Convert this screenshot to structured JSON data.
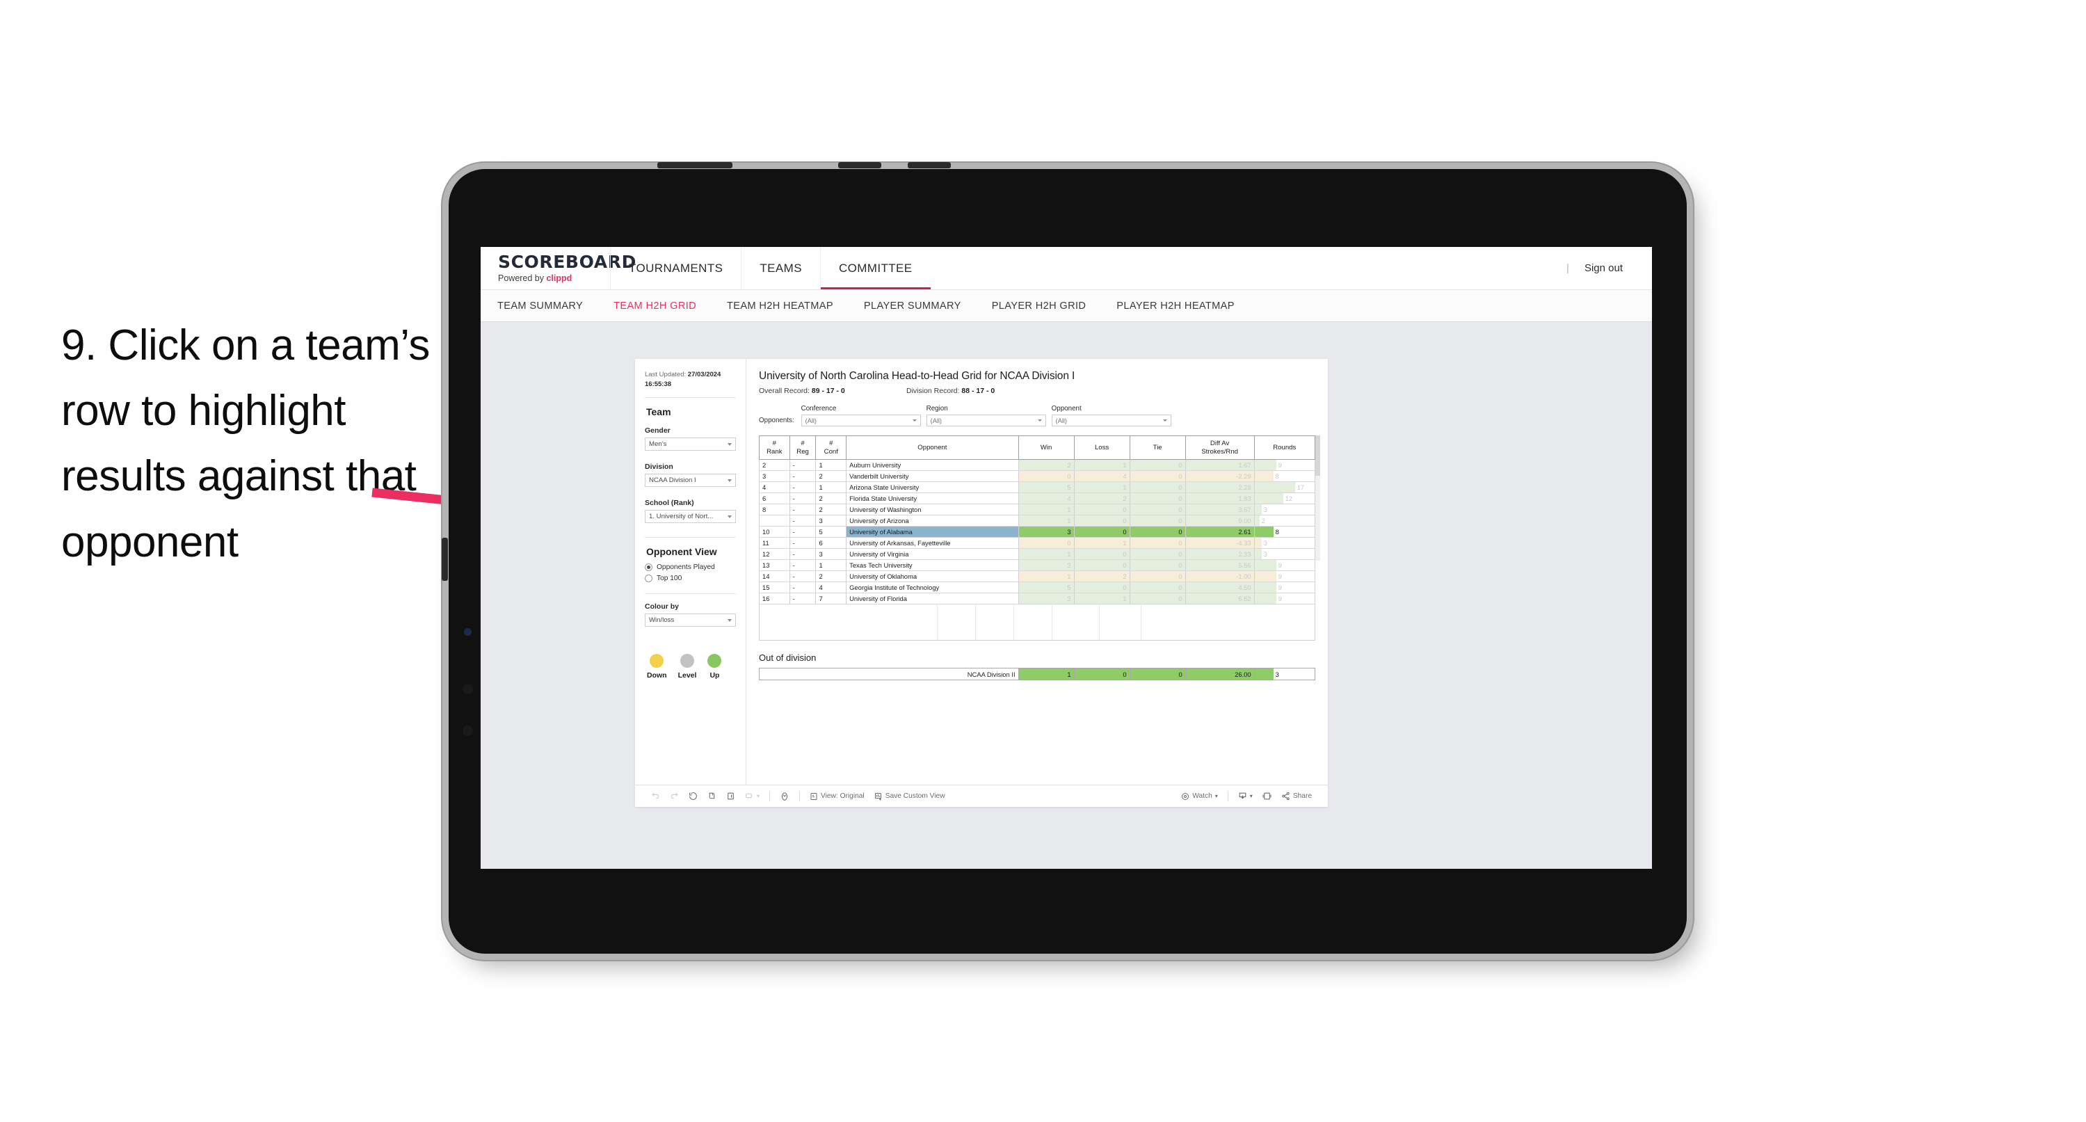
{
  "annotation": {
    "text": "9. Click on a team’s row to highlight results against that opponent",
    "arrow_color": "#ec2d62"
  },
  "app": {
    "brand_name": "SCOREBOARD",
    "brand_powered_prefix": "Powered by ",
    "brand_powered_name": "clippd",
    "top_nav": [
      {
        "label": "TOURNAMENTS",
        "active": false
      },
      {
        "label": "TEAMS",
        "active": false
      },
      {
        "label": "COMMITTEE",
        "active": true
      }
    ],
    "sign_out": "Sign out",
    "sub_nav": [
      {
        "label": "TEAM SUMMARY",
        "active": false
      },
      {
        "label": "TEAM H2H GRID",
        "active": true
      },
      {
        "label": "TEAM H2H HEATMAP",
        "active": false
      },
      {
        "label": "PLAYER SUMMARY",
        "active": false
      },
      {
        "label": "PLAYER H2H GRID",
        "active": false
      },
      {
        "label": "PLAYER H2H HEATMAP",
        "active": false
      }
    ],
    "accent_color": "#e8315f"
  },
  "sidebar": {
    "last_updated_label": "Last Updated: ",
    "last_updated_value": "27/03/2024 16:55:38",
    "team_heading": "Team",
    "gender_label": "Gender",
    "gender_value": "Men’s",
    "division_label": "Division",
    "division_value": "NCAA Division I",
    "school_label": "School (Rank)",
    "school_value": "1. University of Nort...",
    "opponent_view_heading": "Opponent View",
    "opponent_view_options": [
      {
        "label": "Opponents Played",
        "selected": true
      },
      {
        "label": "Top 100",
        "selected": false
      }
    ],
    "colour_by_label": "Colour by",
    "colour_by_value": "Win/loss",
    "legend": [
      {
        "label": "Down",
        "color": "#f2d24b"
      },
      {
        "label": "Level",
        "color": "#c2c2c2"
      },
      {
        "label": "Up",
        "color": "#86c75f"
      }
    ]
  },
  "viz": {
    "title": "University of North Carolina Head-to-Head Grid for NCAA Division I",
    "overall_record_label": "Overall Record: ",
    "overall_record_value": "89 - 17 - 0",
    "division_record_label": "Division Record: ",
    "division_record_value": "88 - 17 - 0",
    "opponents_label": "Opponents:",
    "filters": [
      {
        "label": "Conference",
        "value": "(All)"
      },
      {
        "label": "Region",
        "value": "(All)"
      },
      {
        "label": "Opponent",
        "value": "(All)"
      }
    ],
    "columns": [
      {
        "line1": "#",
        "line2": "Rank"
      },
      {
        "line1": "#",
        "line2": "Reg"
      },
      {
        "line1": "#",
        "line2": "Conf"
      },
      {
        "line1": "Opponent",
        "line2": ""
      },
      {
        "line1": "Win",
        "line2": ""
      },
      {
        "line1": "Loss",
        "line2": ""
      },
      {
        "line1": "Tie",
        "line2": ""
      },
      {
        "line1": "Diff Av",
        "line2": "Strokes/Rnd"
      },
      {
        "line1": "Rounds",
        "line2": ""
      }
    ],
    "rows": [
      {
        "rank": "2",
        "reg": "-",
        "conf": "1",
        "opponent": "Auburn University",
        "win": "2",
        "loss": "1",
        "tie": "0",
        "diff": "1.67",
        "rounds": "9",
        "tone": "up",
        "selected": false
      },
      {
        "rank": "3",
        "reg": "-",
        "conf": "2",
        "opponent": "Vanderbilt University",
        "win": "0",
        "loss": "4",
        "tie": "0",
        "diff": "-2.29",
        "rounds": "8",
        "tone": "down",
        "selected": false
      },
      {
        "rank": "4",
        "reg": "-",
        "conf": "1",
        "opponent": "Arizona State University",
        "win": "5",
        "loss": "1",
        "tie": "0",
        "diff": "2.28",
        "rounds": "17",
        "tone": "up",
        "selected": false
      },
      {
        "rank": "6",
        "reg": "-",
        "conf": "2",
        "opponent": "Florida State University",
        "win": "4",
        "loss": "2",
        "tie": "0",
        "diff": "1.83",
        "rounds": "12",
        "tone": "up",
        "selected": false
      },
      {
        "rank": "8",
        "reg": "-",
        "conf": "2",
        "opponent": "University of Washington",
        "win": "1",
        "loss": "0",
        "tie": "0",
        "diff": "3.67",
        "rounds": "3",
        "tone": "up",
        "selected": false
      },
      {
        "rank": "",
        "reg": "-",
        "conf": "3",
        "opponent": "University of Arizona",
        "win": "1",
        "loss": "0",
        "tie": "0",
        "diff": "9.00",
        "rounds": "2",
        "tone": "up",
        "selected": false
      },
      {
        "rank": "10",
        "reg": "-",
        "conf": "5",
        "opponent": "University of Alabama",
        "win": "3",
        "loss": "0",
        "tie": "0",
        "diff": "2.61",
        "rounds": "8",
        "tone": "up",
        "selected": true
      },
      {
        "rank": "11",
        "reg": "-",
        "conf": "6",
        "opponent": "University of Arkansas, Fayetteville",
        "win": "0",
        "loss": "1",
        "tie": "0",
        "diff": "-4.33",
        "rounds": "3",
        "tone": "down",
        "selected": false
      },
      {
        "rank": "12",
        "reg": "-",
        "conf": "3",
        "opponent": "University of Virginia",
        "win": "1",
        "loss": "0",
        "tie": "0",
        "diff": "2.33",
        "rounds": "3",
        "tone": "up",
        "selected": false
      },
      {
        "rank": "13",
        "reg": "-",
        "conf": "1",
        "opponent": "Texas Tech University",
        "win": "3",
        "loss": "0",
        "tie": "0",
        "diff": "5.56",
        "rounds": "9",
        "tone": "up",
        "selected": false
      },
      {
        "rank": "14",
        "reg": "-",
        "conf": "2",
        "opponent": "University of Oklahoma",
        "win": "1",
        "loss": "2",
        "tie": "0",
        "diff": "-1.00",
        "rounds": "9",
        "tone": "down",
        "selected": false
      },
      {
        "rank": "15",
        "reg": "-",
        "conf": "4",
        "opponent": "Georgia Institute of Technology",
        "win": "5",
        "loss": "0",
        "tie": "0",
        "diff": "4.50",
        "rounds": "9",
        "tone": "up",
        "selected": false
      },
      {
        "rank": "16",
        "reg": "-",
        "conf": "7",
        "opponent": "University of Florida",
        "win": "3",
        "loss": "1",
        "tie": "0",
        "diff": "6.62",
        "rounds": "9",
        "tone": "up",
        "selected": false
      }
    ],
    "out_of_division_title": "Out of division",
    "out_of_division_row": {
      "name": "NCAA Division II",
      "win": "1",
      "loss": "0",
      "tie": "0",
      "diff": "26.00",
      "rounds": "3"
    }
  },
  "toolbar": {
    "view_label": "View: Original",
    "save_label": "Save Custom View",
    "watch_label": "Watch",
    "share_label": "Share"
  },
  "chart_data": {
    "type": "table",
    "title": "University of North Carolina Head-to-Head Grid for NCAA Division I",
    "columns": [
      "# Rank",
      "# Reg",
      "# Conf",
      "Opponent",
      "Win",
      "Loss",
      "Tie",
      "Diff Av Strokes/Rnd",
      "Rounds"
    ],
    "rows": [
      [
        "2",
        "-",
        "1",
        "Auburn University",
        2,
        1,
        0,
        1.67,
        9
      ],
      [
        "3",
        "-",
        "2",
        "Vanderbilt University",
        0,
        4,
        0,
        -2.29,
        8
      ],
      [
        "4",
        "-",
        "1",
        "Arizona State University",
        5,
        1,
        0,
        2.28,
        17
      ],
      [
        "6",
        "-",
        "2",
        "Florida State University",
        4,
        2,
        0,
        1.83,
        12
      ],
      [
        "8",
        "-",
        "2",
        "University of Washington",
        1,
        0,
        0,
        3.67,
        3
      ],
      [
        "",
        "-",
        "3",
        "University of Arizona",
        1,
        0,
        0,
        9.0,
        2
      ],
      [
        "10",
        "-",
        "5",
        "University of Alabama",
        3,
        0,
        0,
        2.61,
        8
      ],
      [
        "11",
        "-",
        "6",
        "University of Arkansas, Fayetteville",
        0,
        1,
        0,
        -4.33,
        3
      ],
      [
        "12",
        "-",
        "3",
        "University of Virginia",
        1,
        0,
        0,
        2.33,
        3
      ],
      [
        "13",
        "-",
        "1",
        "Texas Tech University",
        3,
        0,
        0,
        5.56,
        9
      ],
      [
        "14",
        "-",
        "2",
        "University of Oklahoma",
        1,
        2,
        0,
        -1.0,
        9
      ],
      [
        "15",
        "-",
        "4",
        "Georgia Institute of Technology",
        5,
        0,
        0,
        4.5,
        9
      ],
      [
        "16",
        "-",
        "7",
        "University of Florida",
        3,
        1,
        0,
        6.62,
        9
      ]
    ],
    "out_of_division": [
      [
        "NCAA Division II",
        1,
        0,
        0,
        26.0,
        3
      ]
    ],
    "colour_by": "Win/loss",
    "legend": [
      "Down",
      "Level",
      "Up"
    ],
    "selected_row": "University of Alabama"
  }
}
